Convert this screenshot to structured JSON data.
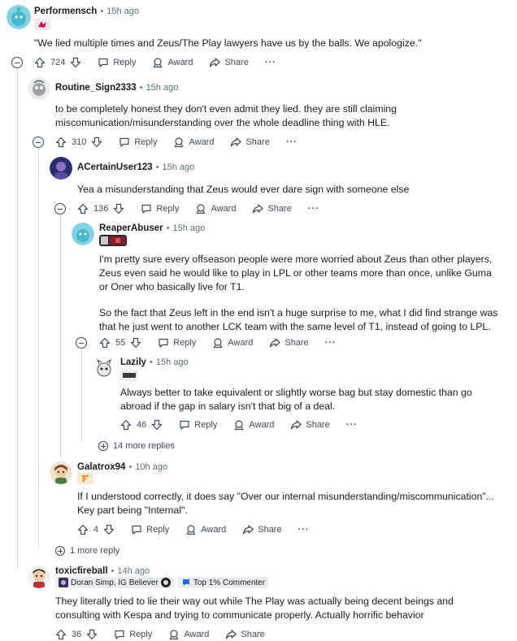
{
  "comments": [
    {
      "username": "Performensch",
      "time": "15h ago",
      "body": [
        "\"We lied multiple times and Zeus/The Play lawyers have us by the balls. We apologize.\""
      ],
      "votes": "724",
      "reply": "Reply",
      "award": "Award",
      "share": "Share"
    },
    {
      "username": "Routine_Sign2333",
      "time": "15h ago",
      "body": [
        "to be completely honest they don't even admit they lied. they are still claiming miscomunication/misunderstanding over the whole deadline thing with HLE."
      ],
      "votes": "310",
      "reply": "Reply",
      "award": "Award",
      "share": "Share"
    },
    {
      "username": "ACertainUser123",
      "time": "15h ago",
      "body": [
        "Yea a misunderstanding that Zeus would ever dare sign with someone else"
      ],
      "votes": "136",
      "reply": "Reply",
      "award": "Award",
      "share": "Share"
    },
    {
      "username": "ReaperAbuser",
      "time": "15h ago",
      "body": [
        "I'm pretty sure every offseason people were more worried about Zeus than other players, Zeus even said he would like to play in LPL or other teams more than once, unlike Guma or Oner who basically live for T1.",
        "So the fact that Zeus left in the end isn't a huge surprise to me, what I did find strange was that he just went to another LCK team with the same level of T1, instead of going to LPL."
      ],
      "votes": "55",
      "reply": "Reply",
      "award": "Award",
      "share": "Share"
    },
    {
      "username": "Lazily",
      "time": "15h ago",
      "body": [
        "Always better to take equivalent or slightly worse bag but stay domestic than go abroad if the gap in salary isn't that big of a deal."
      ],
      "votes": "46",
      "reply": "Reply",
      "award": "Award",
      "share": "Share"
    },
    {
      "username": "Galatrox94",
      "time": "10h ago",
      "body": [
        "If I understood correctly, it does say \"Over our internal misunderstanding/miscommunication\"... Key part being \"Internal\"."
      ],
      "votes": "4",
      "reply": "Reply",
      "award": "Award",
      "share": "Share"
    },
    {
      "username": "toxicfireball",
      "time": "14h ago",
      "flair_text": "Doran Simp, IG Believer",
      "badge_text": "Top 1% Commenter",
      "body": [
        "They literally tried to lie their way out while The Play was actually being decent beings and consulting with Kespa and trying to communicate properly. Actually horrific behavior"
      ],
      "votes": "36",
      "reply": "Reply",
      "award": "Award",
      "share": "Share"
    }
  ],
  "more_replies": {
    "inner": "14 more replies",
    "outer": "1 more reply"
  },
  "colors": {
    "text": "#1a1a1b",
    "meta": "#576f76",
    "thread_line": "#d8dce0",
    "badge_bg": "#eaedef",
    "fnatic_orange": "#f7921e"
  }
}
